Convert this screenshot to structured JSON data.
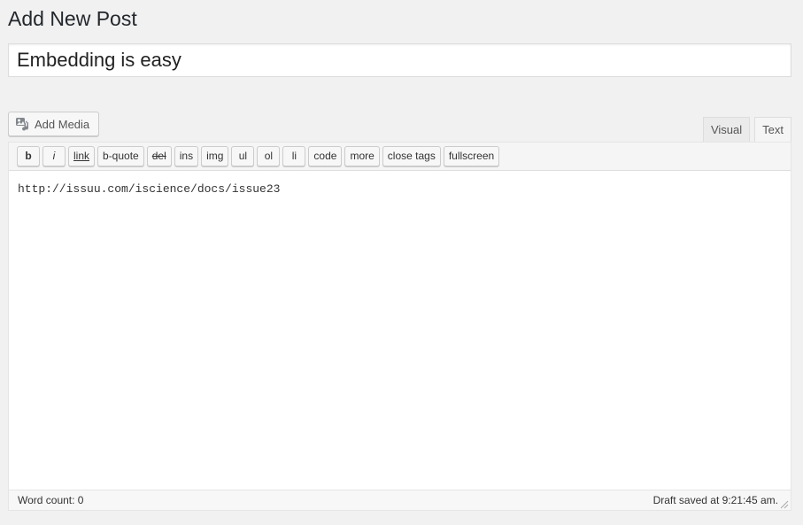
{
  "page": {
    "title": "Add New Post"
  },
  "post": {
    "title_value": "Embedding is easy"
  },
  "media": {
    "add_label": "Add Media",
    "icon": "media-icon"
  },
  "editor_tabs": [
    {
      "label": "Visual",
      "active": false
    },
    {
      "label": "Text",
      "active": true
    }
  ],
  "quicktags": {
    "b": "b",
    "i": "i",
    "link": "link",
    "bquote": "b-quote",
    "del": "del",
    "ins": "ins",
    "img": "img",
    "ul": "ul",
    "ol": "ol",
    "li": "li",
    "code": "code",
    "more": "more",
    "close_tags": "close tags",
    "fullscreen": "fullscreen"
  },
  "content": {
    "text": "http://issuu.com/iscience/docs/issue23"
  },
  "status": {
    "word_count": "Word count: 0",
    "draft_saved": "Draft saved at 9:21:45 am."
  }
}
